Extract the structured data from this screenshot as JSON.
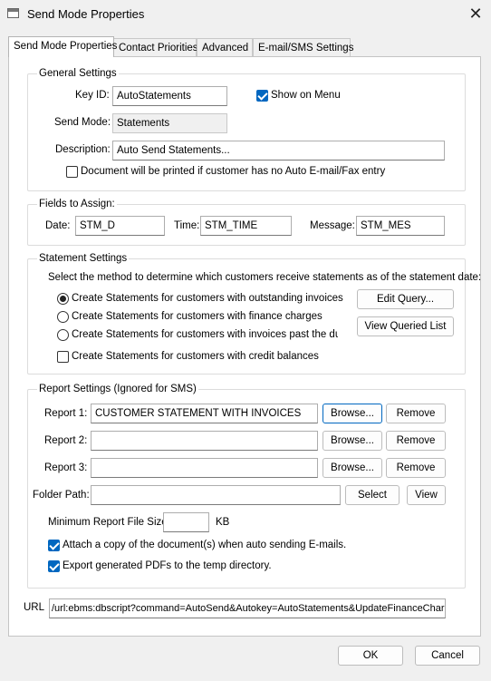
{
  "window": {
    "title": "Send Mode Properties",
    "close_glyph": "✕"
  },
  "tabs": [
    {
      "label": "Send Mode Properties",
      "active": true
    },
    {
      "label": "Contact Priorities",
      "active": false
    },
    {
      "label": "Advanced",
      "active": false
    },
    {
      "label": "E-mail/SMS Settings",
      "active": false
    }
  ],
  "general": {
    "title": "General Settings",
    "key_id_label": "Key ID:",
    "key_id_value": "AutoStatements",
    "show_on_menu_label": "Show on Menu",
    "show_on_menu_checked": true,
    "send_mode_label": "Send Mode:",
    "send_mode_value": "Statements",
    "description_label": "Description:",
    "description_value": "Auto Send Statements...",
    "print_if_no_email_label": "Document will be printed if customer has no Auto E-mail/Fax entry",
    "print_if_no_email_checked": false
  },
  "fields": {
    "title": "Fields to Assign:",
    "date_label": "Date:",
    "date_value": "STM_D",
    "time_label": "Time:",
    "time_value": "STM_TIME",
    "message_label": "Message:",
    "message_value": "STM_MES"
  },
  "statement": {
    "title": "Statement Settings",
    "instructions": "Select the method to determine which customers receive statements as of the statement date:",
    "options": [
      {
        "label": "Create Statements for customers with outstanding invoices",
        "selected": true
      },
      {
        "label": "Create Statements for customers with finance charges",
        "selected": false
      },
      {
        "label": "Create Statements for customers with invoices past the due date",
        "selected": false
      }
    ],
    "credit_balances_label": "Create Statements for customers with credit balances",
    "credit_balances_checked": false,
    "edit_query_label": "Edit Query...",
    "view_queried_label": "View Queried List"
  },
  "report": {
    "title": "Report Settings (Ignored for SMS)",
    "reports": [
      {
        "label": "Report 1:",
        "value": "CUSTOMER STATEMENT WITH INVOICES"
      },
      {
        "label": "Report 2:",
        "value": ""
      },
      {
        "label": "Report 3:",
        "value": ""
      }
    ],
    "browse_label": "Browse...",
    "remove_label": "Remove",
    "folder_path_label": "Folder Path:",
    "folder_path_value": "",
    "select_label": "Select",
    "view_label": "View",
    "min_size_label": "Minimum Report File Size:",
    "min_size_value": "",
    "min_size_unit": "KB",
    "attach_copy_label": "Attach a copy of the document(s) when auto sending E-mails.",
    "attach_copy_checked": true,
    "export_pdfs_label": "Export generated PDFs to the temp directory.",
    "export_pdfs_checked": true
  },
  "url": {
    "label": "URL",
    "value": "/url:ebms:dbscript?command=AutoSend&Autokey=AutoStatements&UpdateFinanceCharges"
  },
  "footer": {
    "ok_label": "OK",
    "cancel_label": "Cancel"
  },
  "colors": {
    "accent": "#0067c0",
    "panel": "#ffffff",
    "dialog": "#f0f0f0"
  }
}
